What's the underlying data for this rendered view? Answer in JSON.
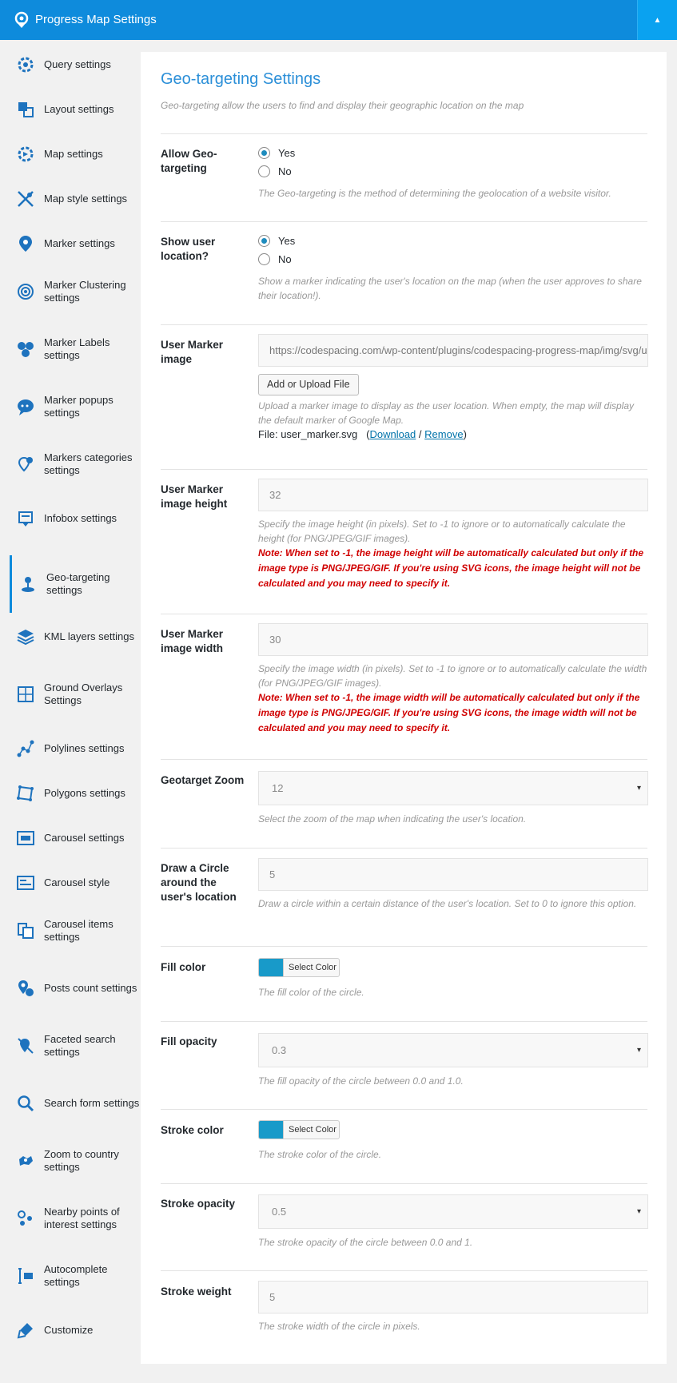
{
  "header": {
    "title": "Progress Map Settings",
    "collapse_glyph": "▲",
    "color": "#0e8bdc"
  },
  "sidebar": {
    "items": [
      {
        "label": "Query settings",
        "icon": "gear-icon"
      },
      {
        "label": "Layout settings",
        "icon": "layout-icon"
      },
      {
        "label": "Map settings",
        "icon": "map-gear-icon"
      },
      {
        "label": "Map style settings",
        "icon": "map-style-icon"
      },
      {
        "label": "Marker settings",
        "icon": "marker-icon"
      },
      {
        "label": "Marker Clustering settings",
        "icon": "cluster-icon"
      },
      {
        "label": "Marker Labels settings",
        "icon": "marker-labels-icon"
      },
      {
        "label": "Marker popups settings",
        "icon": "marker-popup-icon"
      },
      {
        "label": "Markers categories settings",
        "icon": "marker-categories-icon"
      },
      {
        "label": "Infobox settings",
        "icon": "infobox-icon"
      },
      {
        "label": "Geo-targeting settings",
        "icon": "geo-targeting-icon",
        "active": true
      },
      {
        "label": "KML layers settings",
        "icon": "layers-icon"
      },
      {
        "label": "Ground Overlays Settings",
        "icon": "ground-overlay-icon"
      },
      {
        "label": "Polylines settings",
        "icon": "polyline-icon"
      },
      {
        "label": "Polygons settings",
        "icon": "polygon-icon"
      },
      {
        "label": "Carousel settings",
        "icon": "carousel-icon"
      },
      {
        "label": "Carousel style",
        "icon": "carousel-style-icon"
      },
      {
        "label": "Carousel items settings",
        "icon": "carousel-items-icon"
      },
      {
        "label": "Posts count settings",
        "icon": "posts-count-icon"
      },
      {
        "label": "Faceted search settings",
        "icon": "faceted-search-icon"
      },
      {
        "label": "Search form settings",
        "icon": "search-icon"
      },
      {
        "label": "Zoom to country settings",
        "icon": "zoom-country-icon"
      },
      {
        "label": "Nearby points of interest settings",
        "icon": "nearby-poi-icon"
      },
      {
        "label": "Autocomplete settings",
        "icon": "autocomplete-icon"
      },
      {
        "label": "Customize",
        "icon": "customize-icon"
      }
    ]
  },
  "panel": {
    "title": "Geo-targeting Settings",
    "description": "Geo-targeting allow the users to find and display their geographic location on the map"
  },
  "fields": {
    "allow_geo": {
      "label": "Allow Geo-targeting",
      "options": [
        "Yes",
        "No"
      ],
      "selected": "Yes",
      "help": "The Geo-targeting is the method of determining the geolocation of a website visitor."
    },
    "show_user": {
      "label": "Show user location?",
      "options": [
        "Yes",
        "No"
      ],
      "selected": "Yes",
      "help": "Show a marker indicating the user's location on the map (when the user approves to share their location!)."
    },
    "marker_image": {
      "label": "User Marker image",
      "value": "https://codespacing.com/wp-content/plugins/codespacing-progress-map/img/svg/user_marker.svg",
      "button": "Add or Upload File",
      "help": "Upload a marker image to display as the user location. When empty, the map will display the default marker of Google Map.",
      "file_prefix": "File:",
      "file_name": "user_marker.svg",
      "download": "Download",
      "separator": "/",
      "remove": "Remove",
      "paren_open": "(",
      "paren_close": ")"
    },
    "marker_height": {
      "label": "User Marker image height",
      "value": "32",
      "help": "Specify the image height (in pixels). Set to -1 to ignore or to automatically calculate the height (for PNG/JPEG/GIF images).",
      "note": "Note: When set to -1, the image height will be automatically calculated but only if the image type is PNG/JPEG/GIF. If you're using SVG icons, the image height will not be calculated and you may need to specify it."
    },
    "marker_width": {
      "label": "User Marker image width",
      "value": "30",
      "help": "Specify the image width (in pixels). Set to -1 to ignore or to automatically calculate the width (for PNG/JPEG/GIF images).",
      "note": "Note: When set to -1, the image width will be automatically calculated but only if the image type is PNG/JPEG/GIF. If you're using SVG icons, the image width will not be calculated and you may need to specify it."
    },
    "geotarget_zoom": {
      "label": "Geotarget Zoom",
      "value": "12",
      "help": "Select the zoom of the map when indicating the user's location."
    },
    "circle": {
      "label": "Draw a Circle around the user's location",
      "value": "5",
      "help": "Draw a circle within a certain distance of the user's location. Set to 0 to ignore this option."
    },
    "fill_color": {
      "label": "Fill color",
      "color": "#189ac9",
      "button": "Select Color",
      "help": "The fill color of the circle."
    },
    "fill_opacity": {
      "label": "Fill opacity",
      "value": "0.3",
      "help": "The fill opacity of the circle between 0.0 and 1.0."
    },
    "stroke_color": {
      "label": "Stroke color",
      "color": "#189ac9",
      "button": "Select Color",
      "help": "The stroke color of the circle."
    },
    "stroke_opacity": {
      "label": "Stroke opacity",
      "value": "0.5",
      "help": "The stroke opacity of the circle between 0.0 and 1."
    },
    "stroke_weight": {
      "label": "Stroke weight",
      "value": "5",
      "help": "The stroke width of the circle in pixels."
    }
  },
  "caret": "▾"
}
